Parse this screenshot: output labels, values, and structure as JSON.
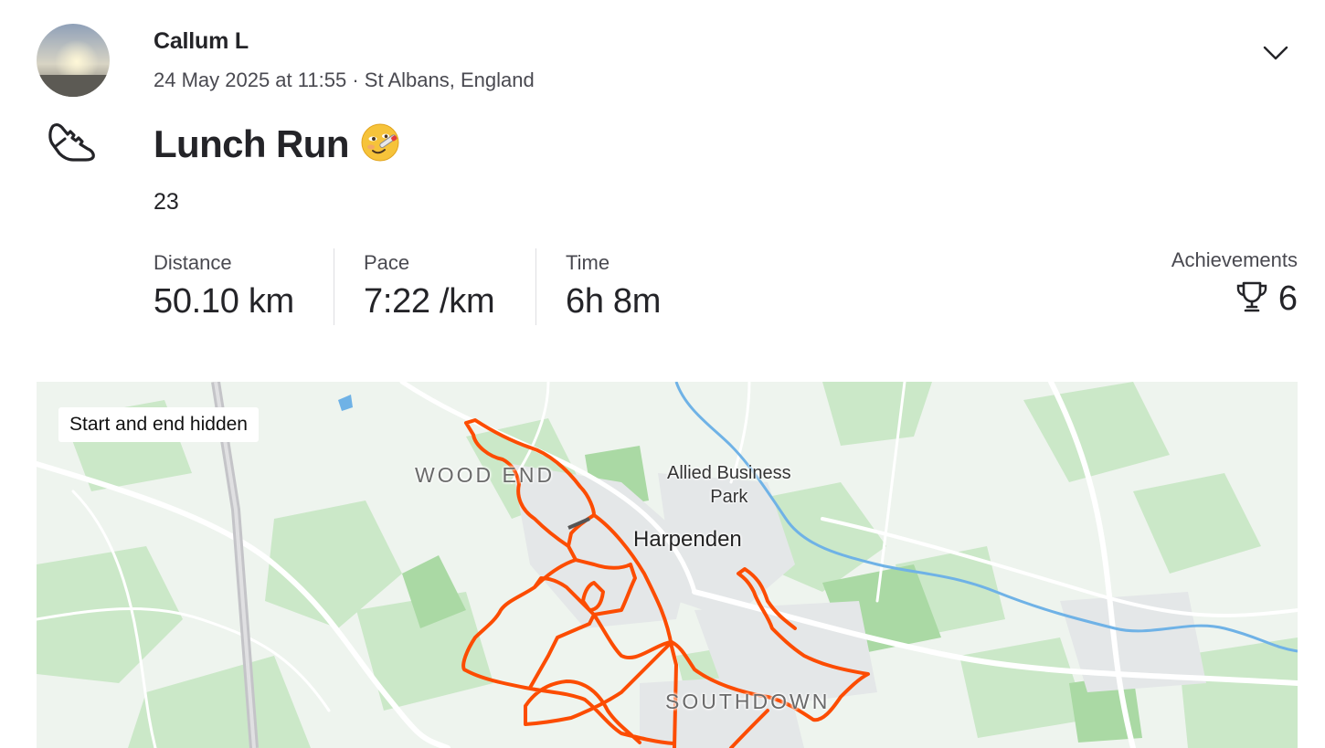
{
  "athlete": {
    "name": "Callum L"
  },
  "meta": {
    "date_time": "24 May 2025 at 11:55",
    "separator": " · ",
    "location": "St Albans, England"
  },
  "activity": {
    "sport_icon": "running-shoe-icon",
    "title": "Lunch Run",
    "emoji": "🤒",
    "description": "23"
  },
  "stats": [
    {
      "label": "Distance",
      "value": "50.10 km"
    },
    {
      "label": "Pace",
      "value": "7:22 /km"
    },
    {
      "label": "Time",
      "value": "6h 8m"
    }
  ],
  "achievements": {
    "label": "Achievements",
    "icon": "trophy-icon",
    "count": "6"
  },
  "map": {
    "badge": "Start and end hidden",
    "labels": {
      "wood_end": "WOOD END",
      "allied_1": "Allied Business",
      "allied_2": "Park",
      "harpenden": "Harpenden",
      "southdown": "SOUTHDOWN"
    },
    "route_color": "#fc4c02",
    "water_color": "#6fb2e6",
    "park_color": "#c9e7c6"
  },
  "menu": {
    "icon": "chevron-down-icon"
  }
}
